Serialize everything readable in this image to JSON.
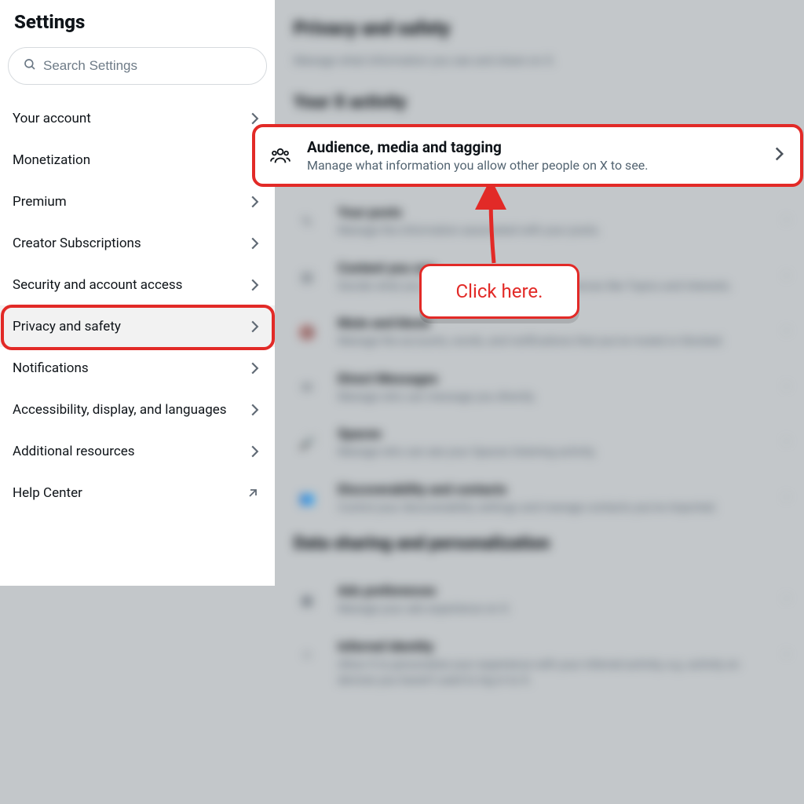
{
  "sidebar": {
    "title": "Settings",
    "search_placeholder": "Search Settings",
    "items": [
      {
        "label": "Your account",
        "kind": "chev"
      },
      {
        "label": "Monetization",
        "kind": "none"
      },
      {
        "label": "Premium",
        "kind": "chev"
      },
      {
        "label": "Creator Subscriptions",
        "kind": "chev"
      },
      {
        "label": "Security and account access",
        "kind": "chev"
      },
      {
        "label": "Privacy and safety",
        "kind": "chev",
        "selected": true
      },
      {
        "label": "Notifications",
        "kind": "chev"
      },
      {
        "label": "Accessibility, display, and languages",
        "kind": "chev"
      },
      {
        "label": "Additional resources",
        "kind": "chev"
      },
      {
        "label": "Help Center",
        "kind": "ext"
      }
    ]
  },
  "main": {
    "title": "Privacy and safety",
    "subtitle": "Manage what information you see and share on X.",
    "section1": "Your X activity",
    "focus": {
      "title": "Audience, media and tagging",
      "desc": "Manage what information you allow other people on X to see."
    },
    "rows1": [
      {
        "t": "Your posts",
        "d": "Manage the information associated with your posts."
      },
      {
        "t": "Content you see",
        "d": "Decide what you see on X based on your preferences like Topics and interests."
      },
      {
        "t": "Mute and block",
        "d": "Manage the accounts, words, and notifications that you've muted or blocked."
      },
      {
        "t": "Direct Messages",
        "d": "Manage who can message you directly."
      },
      {
        "t": "Spaces",
        "d": "Manage who can see your Spaces listening activity."
      },
      {
        "t": "Discoverability and contacts",
        "d": "Control your discoverability settings and manage contacts you've imported."
      }
    ],
    "section2": "Data sharing and personalization",
    "rows2": [
      {
        "t": "Ads preferences",
        "d": "Manage your ads experience on X."
      },
      {
        "t": "Inferred identity",
        "d": "Allow X to personalize your experience with your inferred activity, e.g. activity on devices you haven't used to log in to X."
      }
    ]
  },
  "callout": "Click here."
}
